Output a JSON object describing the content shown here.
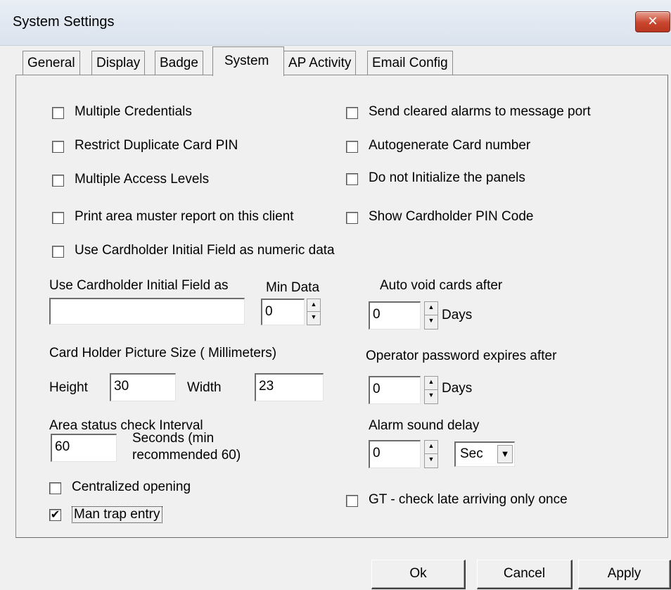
{
  "window": {
    "title": "System Settings",
    "close_glyph": "✕"
  },
  "tabs": [
    "General",
    "Display",
    "Badge",
    "System",
    "AP Activity",
    "Email Config"
  ],
  "active_tab": "System",
  "checkboxes": {
    "multiple_credentials": {
      "label": "Multiple Credentials",
      "checked": false
    },
    "restrict_duplicate_pin": {
      "label": "Restrict Duplicate Card PIN",
      "checked": false
    },
    "multiple_access_levels": {
      "label": "Multiple Access Levels",
      "checked": false
    },
    "print_area_muster": {
      "label": "Print area muster report on this client",
      "checked": false
    },
    "use_initial_numeric": {
      "label": "Use Cardholder Initial Field as numeric data",
      "checked": false
    },
    "send_cleared_alarms": {
      "label": "Send cleared alarms to message port",
      "checked": false
    },
    "autogenerate_card": {
      "label": "Autogenerate Card number",
      "checked": false
    },
    "do_not_initialize": {
      "label": "Do not Initialize the panels",
      "checked": false
    },
    "show_pin_code": {
      "label": "Show Cardholder PIN Code",
      "checked": false
    },
    "centralized_opening": {
      "label": "Centralized opening",
      "checked": false
    },
    "man_trap_entry": {
      "label": "Man trap entry",
      "checked": true
    },
    "gt_check_late": {
      "label": "GT - check late arriving only once",
      "checked": false
    }
  },
  "check_mark": "✔",
  "initial_field": {
    "label": "Use Cardholder Initial Field as",
    "value": ""
  },
  "min_data": {
    "label": "Min Data",
    "value": "0"
  },
  "picture_size": {
    "label": "Card Holder Picture Size ( Millimeters)",
    "height_label": "Height",
    "height_value": "30",
    "width_label": "Width",
    "width_value": "23"
  },
  "area_status": {
    "label": "Area status check Interval",
    "value": "60",
    "unit_line1": "Seconds (min",
    "unit_line2": "recommended 60)"
  },
  "auto_void": {
    "label": "Auto void cards after",
    "value": "0",
    "unit": "Days"
  },
  "password_expiry": {
    "label": "Operator password expires after",
    "value": "0",
    "unit": "Days"
  },
  "alarm_delay": {
    "label": "Alarm sound delay",
    "value": "0",
    "unit_selected": "Sec"
  },
  "buttons": {
    "ok": "Ok",
    "cancel": "Cancel",
    "apply": "Apply"
  },
  "icons": {
    "up_arrow": "▲",
    "down_arrow": "▼"
  }
}
